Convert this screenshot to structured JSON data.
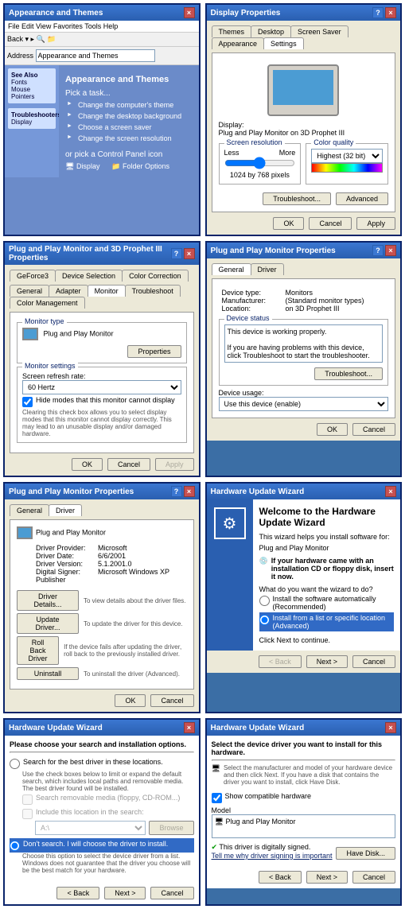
{
  "panel1": {
    "title": "Appearance and Themes",
    "menu": "File  Edit  View  Favorites  Tools  Help",
    "back": "Back",
    "addr_label": "Address",
    "addr": "Appearance and Themes",
    "side1": "See Also",
    "side1a": "Fonts",
    "side1b": "Mouse Pointers",
    "side2": "Troubleshooters",
    "side2a": "Display",
    "heading": "Appearance and Themes",
    "pick": "Pick a task...",
    "t1": "Change the computer's theme",
    "t2": "Change the desktop background",
    "t3": "Choose a screen saver",
    "t4": "Change the screen resolution",
    "or": "or pick a Control Panel icon",
    "i1": "Display",
    "i2": "Folder Options"
  },
  "panel2": {
    "title": "Display Properties",
    "tabs": [
      "Themes",
      "Desktop",
      "Screen Saver",
      "Appearance",
      "Settings"
    ],
    "display_label": "Display:",
    "display_value": "Plug and Play Monitor on 3D Prophet III",
    "res_label": "Screen resolution",
    "less": "Less",
    "more": "More",
    "res_value": "1024 by 768 pixels",
    "quality_label": "Color quality",
    "quality_value": "Highest (32 bit)",
    "troubleshoot": "Troubleshoot...",
    "advanced": "Advanced",
    "ok": "OK",
    "cancel": "Cancel",
    "apply": "Apply"
  },
  "panel3": {
    "title": "Plug and Play Monitor and 3D Prophet III Properties",
    "tabs_row1": [
      "GeForce3",
      "Device Selection",
      "Color Correction"
    ],
    "tabs_row2": [
      "General",
      "Adapter",
      "Monitor",
      "Troubleshoot",
      "Color Management"
    ],
    "mtype": "Monitor type",
    "mname": "Plug and Play Monitor",
    "props": "Properties",
    "msettings": "Monitor settings",
    "refresh_label": "Screen refresh rate:",
    "refresh_value": "60 Hertz",
    "hide_chk": "Hide modes that this monitor cannot display",
    "hide_note": "Clearing this check box allows you to select display modes that this monitor cannot display correctly. This may lead to an unusable display and/or damaged hardware.",
    "ok": "OK",
    "cancel": "Cancel",
    "apply": "Apply"
  },
  "panel4": {
    "title": "Plug and Play Monitor Properties",
    "tabs": [
      "General",
      "Driver"
    ],
    "dt": "Device type:",
    "dtv": "Monitors",
    "mf": "Manufacturer:",
    "mfv": "(Standard monitor types)",
    "loc": "Location:",
    "locv": "on 3D Prophet III",
    "status_label": "Device status",
    "status_text": "This device is working properly.",
    "status_help": "If you are having problems with this device, click Troubleshoot to start the troubleshooter.",
    "troubleshoot": "Troubleshoot...",
    "usage_label": "Device usage:",
    "usage_value": "Use this device (enable)",
    "ok": "OK",
    "cancel": "Cancel"
  },
  "panel5": {
    "title": "Plug and Play Monitor Properties",
    "tabs": [
      "General",
      "Driver"
    ],
    "name": "Plug and Play Monitor",
    "provider_l": "Driver Provider:",
    "provider_v": "Microsoft",
    "date_l": "Driver Date:",
    "date_v": "6/6/2001",
    "ver_l": "Driver Version:",
    "ver_v": "5.1.2001.0",
    "signer_l": "Digital Signer:",
    "signer_v": "Microsoft Windows XP Publisher",
    "b1": "Driver Details...",
    "b1t": "To view details about the driver files.",
    "b2": "Update Driver...",
    "b2t": "To update the driver for this device.",
    "b3": "Roll Back Driver",
    "b3t": "If the device fails after updating the driver, roll back to the previously installed driver.",
    "b4": "Uninstall",
    "b4t": "To uninstall the driver (Advanced).",
    "ok": "OK",
    "cancel": "Cancel"
  },
  "panel6": {
    "title": "Hardware Update Wizard",
    "welcome": "Welcome to the Hardware Update Wizard",
    "intro": "This wizard helps you install software for:",
    "device": "Plug and Play Monitor",
    "cd_note": "If your hardware came with an installation CD or floppy disk, insert it now.",
    "what": "What do you want the wizard to do?",
    "r1": "Install the software automatically (Recommended)",
    "r2": "Install from a list or specific location (Advanced)",
    "cont": "Click Next to continue.",
    "back": "< Back",
    "next": "Next >",
    "cancel": "Cancel"
  },
  "panel7": {
    "title": "Hardware Update Wizard",
    "heading": "Please choose your search and installation options.",
    "r1": "Search for the best driver in these locations.",
    "r1_note": "Use the check boxes below to limit or expand the default search, which includes local paths and removable media. The best driver found will be installed.",
    "c1": "Search removable media (floppy, CD-ROM...)",
    "c2": "Include this location in the search:",
    "path": "A:\\",
    "browse": "Browse",
    "r2": "Don't search. I will choose the driver to install.",
    "r2_note": "Choose this option to select the device driver from a list. Windows does not guarantee that the driver you choose will be the best match for your hardware.",
    "back": "< Back",
    "next": "Next >",
    "cancel": "Cancel"
  },
  "panel8": {
    "title": "Hardware Update Wizard",
    "heading": "Select the device driver you want to install for this hardware.",
    "instr": "Select the manufacturer and model of your hardware device and then click Next. If you have a disk that contains the driver you want to install, click Have Disk.",
    "compat": "Show compatible hardware",
    "model_l": "Model",
    "model_v": "Plug and Play Monitor",
    "signed": "This driver is digitally signed.",
    "tell": "Tell me why driver signing is important",
    "havedisk": "Have Disk...",
    "back": "< Back",
    "next": "Next >",
    "cancel": "Cancel"
  }
}
